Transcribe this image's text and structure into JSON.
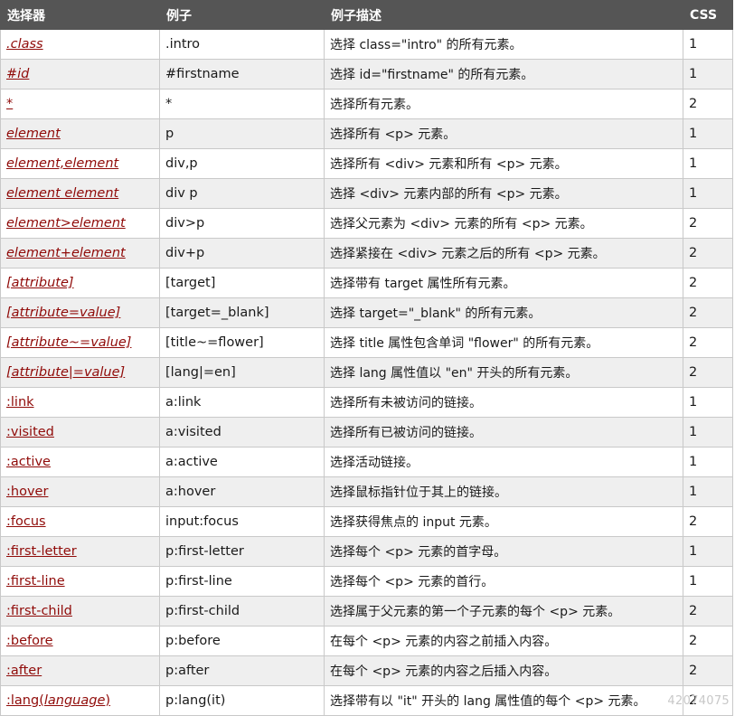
{
  "headers": {
    "selector": "选择器",
    "example": "例子",
    "description": "例子描述",
    "css": "CSS"
  },
  "rows": [
    {
      "selector": ".class",
      "italic": true,
      "example": ".intro",
      "description": "选择 class=\"intro\" 的所有元素。",
      "css": "1"
    },
    {
      "selector": "#id",
      "italic": true,
      "example": "#firstname",
      "description": "选择 id=\"firstname\" 的所有元素。",
      "css": "1"
    },
    {
      "selector": "*",
      "italic": false,
      "example": "*",
      "description": "选择所有元素。",
      "css": "2"
    },
    {
      "selector": "element",
      "italic": true,
      "example": "p",
      "description": "选择所有 <p> 元素。",
      "css": "1"
    },
    {
      "selector": "element,element",
      "italic": true,
      "example": "div,p",
      "description": "选择所有 <div> 元素和所有 <p> 元素。",
      "css": "1"
    },
    {
      "selector": "element element",
      "italic": true,
      "example": "div p",
      "description": "选择 <div> 元素内部的所有 <p> 元素。",
      "css": "1"
    },
    {
      "selector": "element>element",
      "italic": true,
      "example": "div>p",
      "description": "选择父元素为 <div> 元素的所有 <p> 元素。",
      "css": "2"
    },
    {
      "selector": "element+element",
      "italic": true,
      "example": "div+p",
      "description": "选择紧接在 <div> 元素之后的所有 <p> 元素。",
      "css": "2"
    },
    {
      "selector": "[attribute]",
      "italic": true,
      "example": "[target]",
      "description": "选择带有 target 属性所有元素。",
      "css": "2"
    },
    {
      "selector": "[attribute=value]",
      "italic": true,
      "example": "[target=_blank]",
      "description": "选择 target=\"_blank\" 的所有元素。",
      "css": "2"
    },
    {
      "selector": "[attribute~=value]",
      "italic": true,
      "example": "[title~=flower]",
      "description": "选择 title 属性包含单词 \"flower\" 的所有元素。",
      "css": "2"
    },
    {
      "selector": "[attribute|=value]",
      "italic": true,
      "example": "[lang|=en]",
      "description": "选择 lang 属性值以 \"en\" 开头的所有元素。",
      "css": "2"
    },
    {
      "selector": ":link",
      "italic": false,
      "example": "a:link",
      "description": "选择所有未被访问的链接。",
      "css": "1"
    },
    {
      "selector": ":visited",
      "italic": false,
      "example": "a:visited",
      "description": "选择所有已被访问的链接。",
      "css": "1"
    },
    {
      "selector": ":active",
      "italic": false,
      "example": "a:active",
      "description": "选择活动链接。",
      "css": "1"
    },
    {
      "selector": ":hover",
      "italic": false,
      "example": "a:hover",
      "description": "选择鼠标指针位于其上的链接。",
      "css": "1"
    },
    {
      "selector": ":focus",
      "italic": false,
      "example": "input:focus",
      "description": "选择获得焦点的 input 元素。",
      "css": "2"
    },
    {
      "selector": ":first-letter",
      "italic": false,
      "example": "p:first-letter",
      "description": "选择每个 <p> 元素的首字母。",
      "css": "1"
    },
    {
      "selector": ":first-line",
      "italic": false,
      "example": "p:first-line",
      "description": "选择每个 <p> 元素的首行。",
      "css": "1"
    },
    {
      "selector": ":first-child",
      "italic": false,
      "example": "p:first-child",
      "description": "选择属于父元素的第一个子元素的每个 <p> 元素。",
      "css": "2"
    },
    {
      "selector": ":before",
      "italic": false,
      "example": "p:before",
      "description": "在每个 <p> 元素的内容之前插入内容。",
      "css": "2"
    },
    {
      "selector": ":after",
      "italic": false,
      "example": "p:after",
      "description": "在每个 <p> 元素的内容之后插入内容。",
      "css": "2"
    },
    {
      "selector_prefix": ":lang(",
      "selector_arg": "language",
      "selector_suffix": ")",
      "example": "p:lang(it)",
      "description": "选择带有以 \"it\" 开头的 lang 属性值的每个 <p> 元素。",
      "css": "2"
    }
  ],
  "watermark": "42074075",
  "colors": {
    "header_bg": "#555555",
    "link": "#900b09",
    "row_alt": "#efefef",
    "border": "#c9c9c9"
  }
}
